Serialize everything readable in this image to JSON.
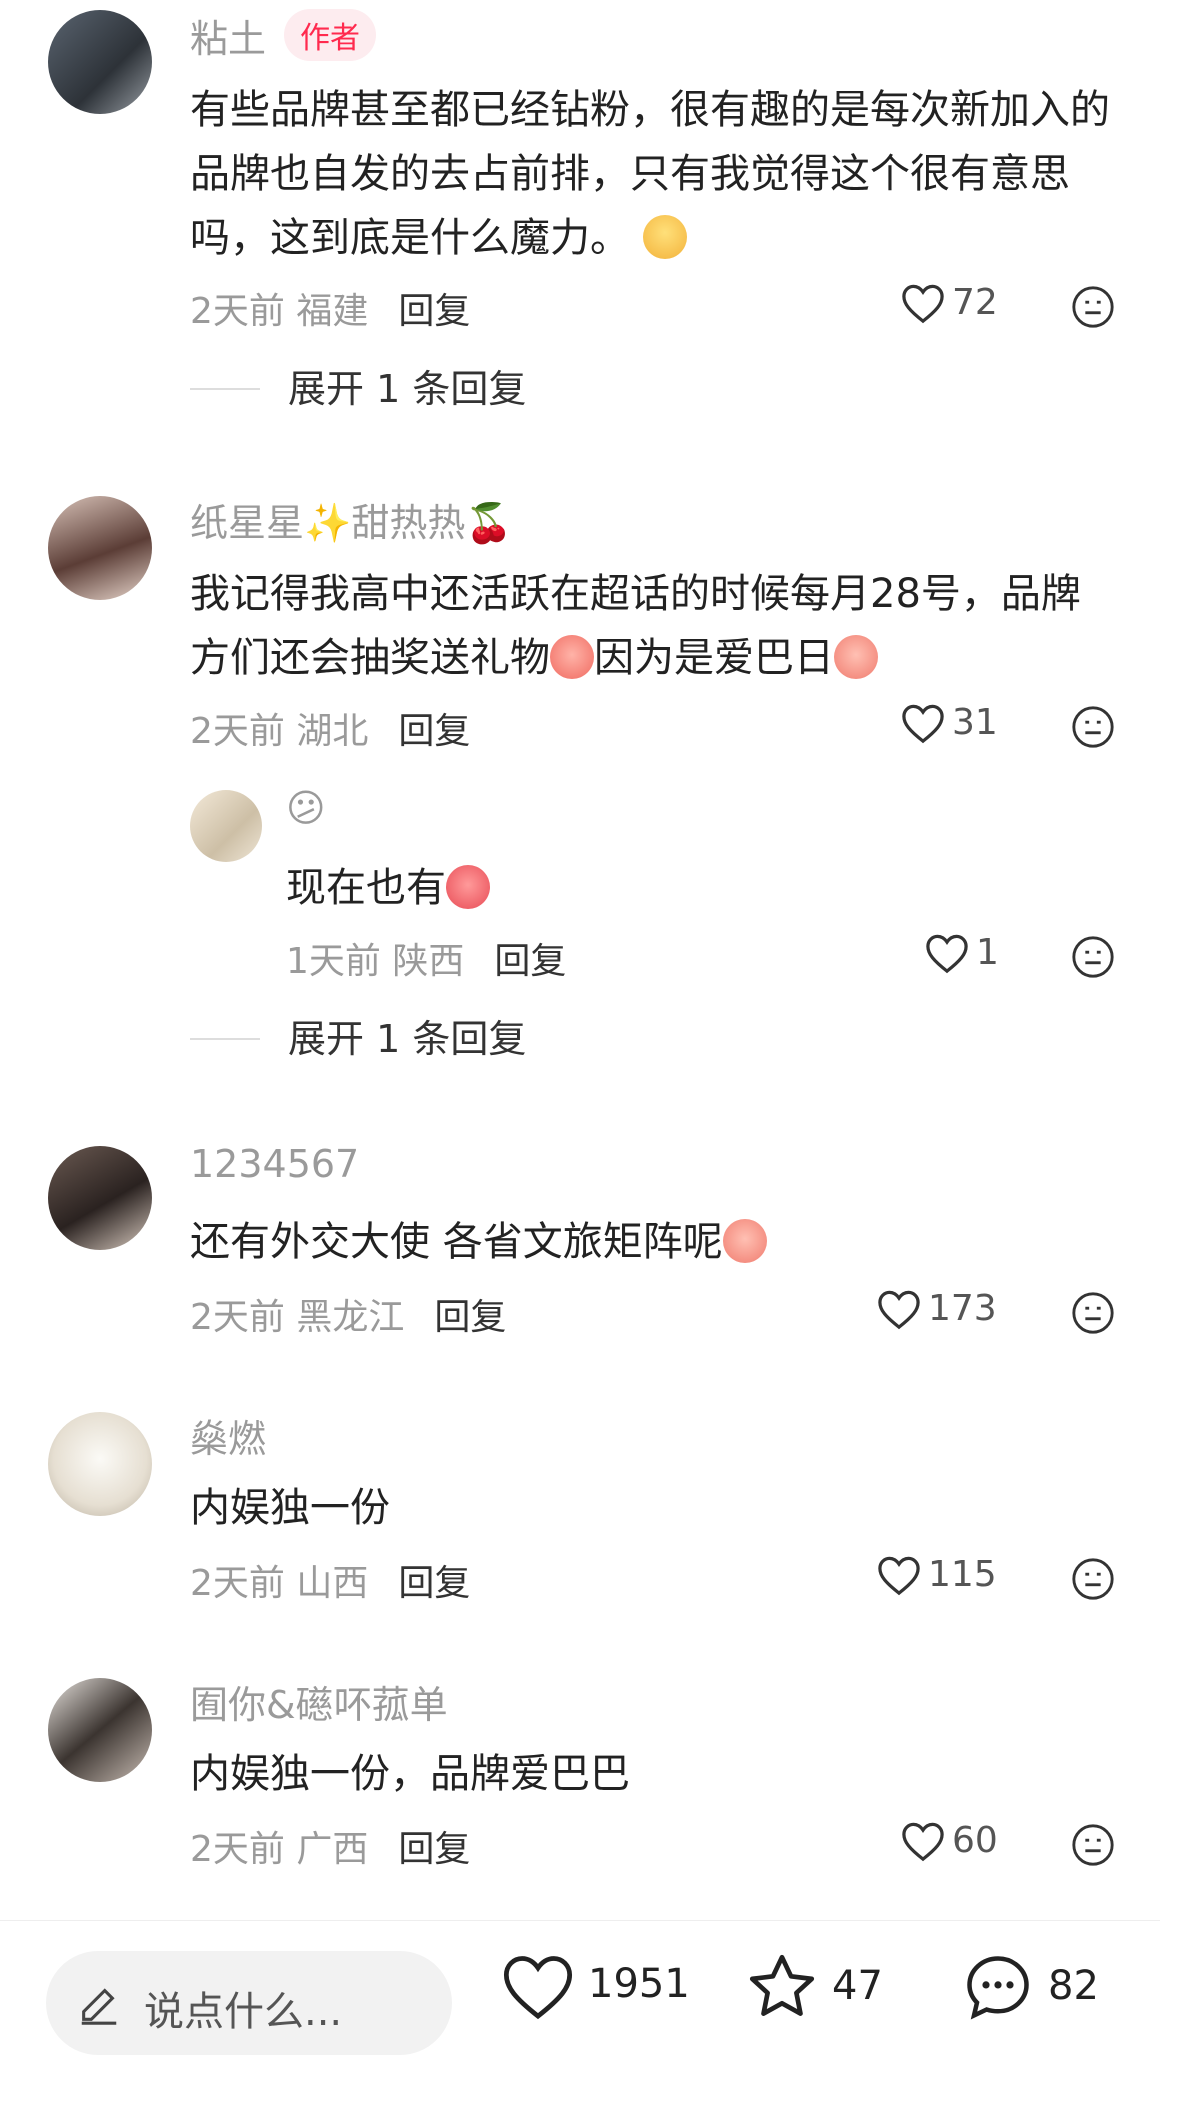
{
  "comments": [
    {
      "username": "粘土",
      "author_tag": "作者",
      "text": "有些品牌甚至都已经钻粉，很有趣的是每次新加入的品牌也自发的去占前排，只有我觉得这个很有意思吗，这到底是什么魔力。",
      "time": "2天前",
      "location": "福建",
      "reply_label": "回复",
      "likes": "72",
      "expand": "展开 1 条回复"
    },
    {
      "username": "纸星星✨甜热热🍒",
      "text": "我记得我高中还活跃在超话的时候每月28号，品牌方们还会抽奖送礼物",
      "text2": "因为是爱巴日",
      "time": "2天前",
      "location": "湖北",
      "reply_label": "回复",
      "likes": "31",
      "reply": {
        "username": "😕",
        "text": "现在也有",
        "time": "1天前",
        "location": "陕西",
        "reply_label": "回复",
        "likes": "1"
      },
      "expand": "展开 1 条回复"
    },
    {
      "username": "1234567",
      "text": "还有外交大使 各省文旅矩阵呢",
      "time": "2天前",
      "location": "黑龙江",
      "reply_label": "回复",
      "likes": "173"
    },
    {
      "username": "燊燃",
      "text": "内娱独一份",
      "time": "2天前",
      "location": "山西",
      "reply_label": "回复",
      "likes": "115"
    },
    {
      "username": "囿你&礠吥菰单",
      "text": "内娱独一份，品牌爱巴巴",
      "time": "2天前",
      "location": "广西",
      "reply_label": "回复",
      "likes": "60"
    }
  ],
  "bottom_bar": {
    "input_placeholder": "说点什么...",
    "likes": "1951",
    "stars": "47",
    "comments": "82"
  }
}
